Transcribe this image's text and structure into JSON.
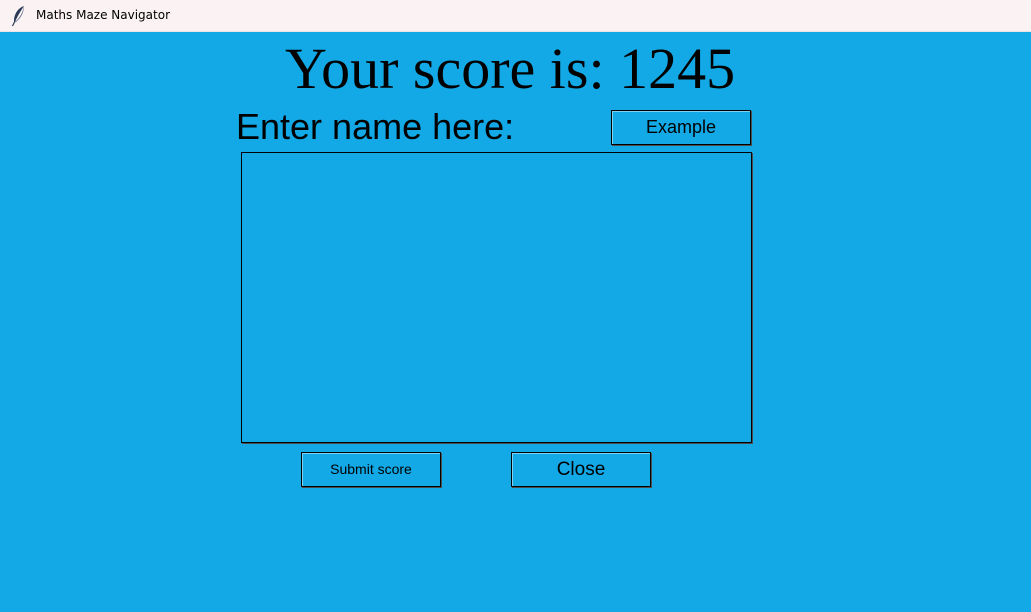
{
  "window": {
    "title": "Maths Maze Navigator",
    "icon": "feather-icon"
  },
  "score": {
    "label": "Your score is: 1245",
    "value": 1245
  },
  "name_entry": {
    "label": "Enter name here:",
    "value": "",
    "example_button_label": "Example"
  },
  "actions": {
    "submit_label": "Submit score",
    "close_label": "Close"
  },
  "colors": {
    "background": "#12a9e6",
    "titlebar": "#fbf3f3",
    "text": "#000000"
  }
}
